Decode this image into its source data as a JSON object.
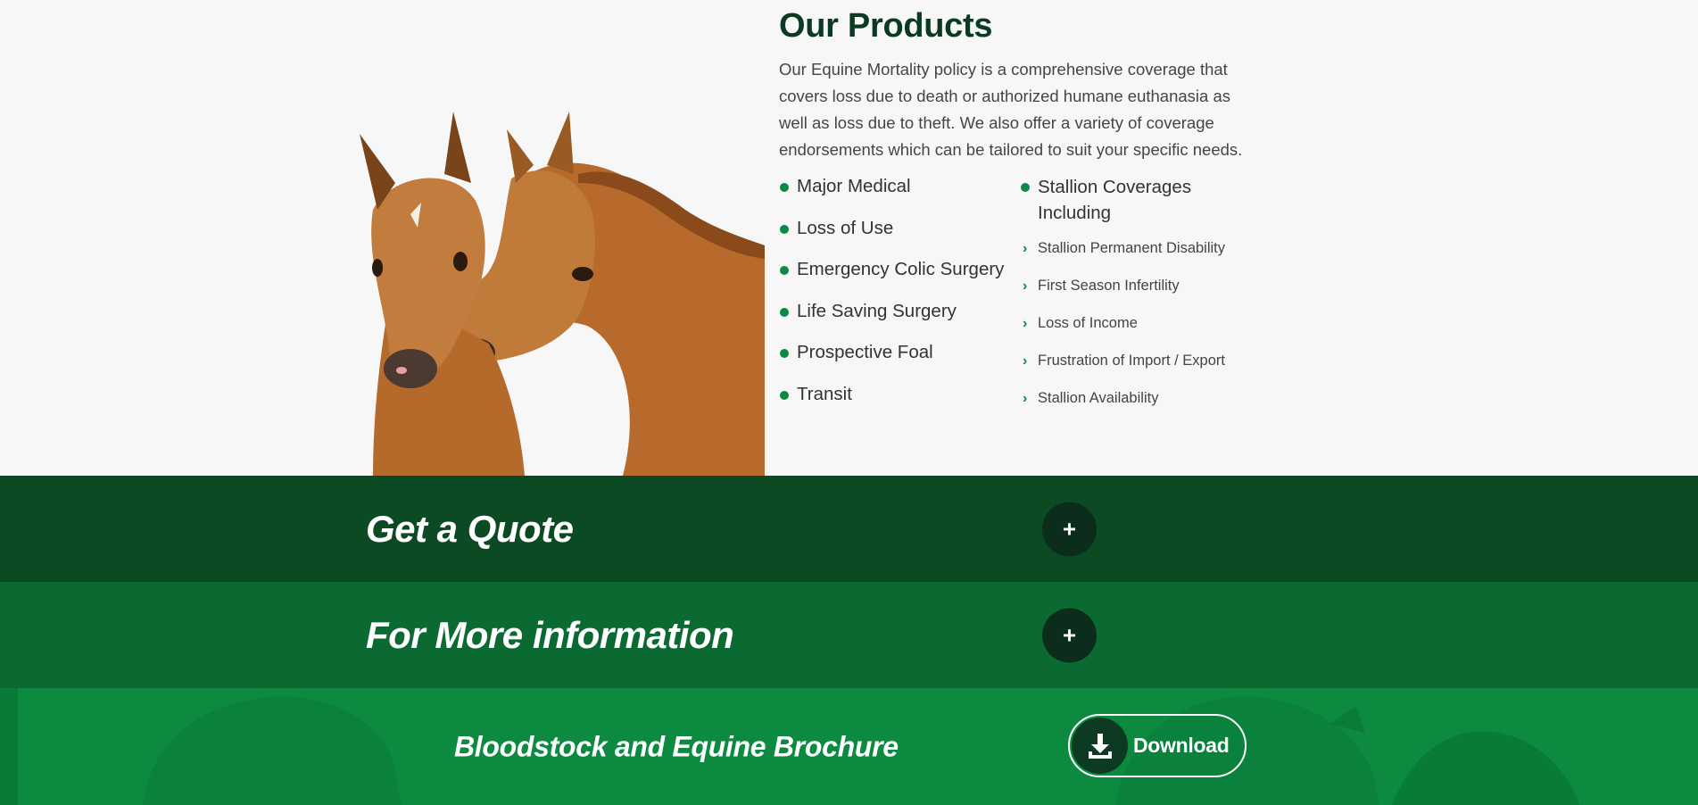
{
  "products": {
    "title": "Our Products",
    "description": "Our Equine Mortality policy is a comprehensive coverage that covers loss due to death or authorized humane euthanasia as well as loss due to theft. We also offer a variety of coverage endorsements which can be tailored to suit your specific needs.",
    "left_items": [
      {
        "label": "Major Medical"
      },
      {
        "label": "Loss of Use"
      },
      {
        "label": "Emergency Colic Surgery"
      },
      {
        "label": "Life Saving Surgery"
      },
      {
        "label": "Prospective Foal"
      },
      {
        "label": "Transit"
      }
    ],
    "stallion_heading": "Stallion Coverages Including",
    "stallion_items": [
      {
        "label": "Stallion Permanent Disability"
      },
      {
        "label": "First Season Infertility"
      },
      {
        "label": "Loss of Income"
      },
      {
        "label": "Frustration of Import / Export"
      },
      {
        "label": "Stallion Availability"
      }
    ]
  },
  "quote": {
    "title": "Get a Quote",
    "toggle": "+"
  },
  "info": {
    "title": "For More information",
    "toggle": "+"
  },
  "brochure": {
    "title": "Bloodstock and Equine Brochure",
    "button_label": "Download"
  },
  "colors": {
    "dark_green": "#0b4a22",
    "mid_green": "#0a6a32",
    "bright_green": "#0b8a40",
    "accent": "#0a8a44",
    "heading": "#0b3a22"
  }
}
